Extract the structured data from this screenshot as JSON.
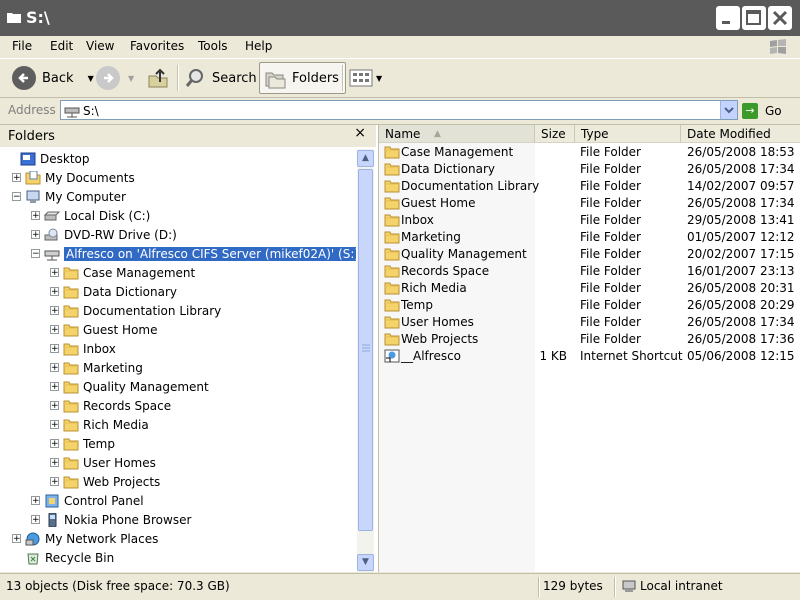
{
  "window": {
    "title": "S:\\"
  },
  "menu": [
    "File",
    "Edit",
    "View",
    "Favorites",
    "Tools",
    "Help"
  ],
  "toolbar": {
    "back": "Back",
    "search": "Search",
    "folders": "Folders"
  },
  "address": {
    "label": "Address",
    "value": "S:\\",
    "go": "Go"
  },
  "folders_pane": {
    "title": "Folders",
    "close": "×",
    "tree": [
      {
        "label": "Desktop",
        "icon": "desktop-icon",
        "level": 0,
        "expander": "none"
      },
      {
        "label": "My Documents",
        "icon": "my-documents-icon",
        "level": 1,
        "expander": "+"
      },
      {
        "label": "My Computer",
        "icon": "my-computer-icon",
        "level": 1,
        "expander": "-"
      },
      {
        "label": "Local Disk (C:)",
        "icon": "hard-disk-icon",
        "level": 2,
        "expander": "+"
      },
      {
        "label": "DVD-RW Drive (D:)",
        "icon": "dvd-drive-icon",
        "level": 2,
        "expander": "+"
      },
      {
        "label": "Alfresco on 'Alfresco CIFS Server (mikef02A)' (S:)",
        "icon": "network-drive-icon",
        "level": 2,
        "expander": "-",
        "selected": true
      },
      {
        "label": "Case Management",
        "icon": "folder-icon",
        "level": 3,
        "expander": "+"
      },
      {
        "label": "Data Dictionary",
        "icon": "folder-icon",
        "level": 3,
        "expander": "+"
      },
      {
        "label": "Documentation Library",
        "icon": "folder-icon",
        "level": 3,
        "expander": "+"
      },
      {
        "label": "Guest Home",
        "icon": "folder-icon",
        "level": 3,
        "expander": "+"
      },
      {
        "label": "Inbox",
        "icon": "folder-icon",
        "level": 3,
        "expander": "+"
      },
      {
        "label": "Marketing",
        "icon": "folder-icon",
        "level": 3,
        "expander": "+"
      },
      {
        "label": "Quality Management",
        "icon": "folder-icon",
        "level": 3,
        "expander": "+"
      },
      {
        "label": "Records Space",
        "icon": "folder-icon",
        "level": 3,
        "expander": "+"
      },
      {
        "label": "Rich Media",
        "icon": "folder-icon",
        "level": 3,
        "expander": "+"
      },
      {
        "label": "Temp",
        "icon": "folder-icon",
        "level": 3,
        "expander": "+"
      },
      {
        "label": "User Homes",
        "icon": "folder-icon",
        "level": 3,
        "expander": "+"
      },
      {
        "label": "Web Projects",
        "icon": "folder-icon",
        "level": 3,
        "expander": "+"
      },
      {
        "label": "Control Panel",
        "icon": "control-panel-icon",
        "level": 2,
        "expander": "+"
      },
      {
        "label": "Nokia Phone Browser",
        "icon": "phone-icon",
        "level": 2,
        "expander": "+"
      },
      {
        "label": "My Network Places",
        "icon": "network-places-icon",
        "level": 1,
        "expander": "+"
      },
      {
        "label": "Recycle Bin",
        "icon": "recycle-bin-icon",
        "level": 1,
        "expander": "none"
      }
    ]
  },
  "list": {
    "columns": [
      "Name",
      "Size",
      "Type",
      "Date Modified"
    ],
    "rows": [
      {
        "name": "Case Management",
        "size": "",
        "type": "File Folder",
        "date": "26/05/2008 18:53",
        "icon": "folder-icon"
      },
      {
        "name": "Data Dictionary",
        "size": "",
        "type": "File Folder",
        "date": "26/05/2008 17:34",
        "icon": "folder-icon"
      },
      {
        "name": "Documentation Library",
        "size": "",
        "type": "File Folder",
        "date": "14/02/2007 09:57",
        "icon": "folder-icon"
      },
      {
        "name": "Guest Home",
        "size": "",
        "type": "File Folder",
        "date": "26/05/2008 17:34",
        "icon": "folder-icon"
      },
      {
        "name": "Inbox",
        "size": "",
        "type": "File Folder",
        "date": "29/05/2008 13:41",
        "icon": "folder-icon"
      },
      {
        "name": "Marketing",
        "size": "",
        "type": "File Folder",
        "date": "01/05/2007 12:12",
        "icon": "folder-icon"
      },
      {
        "name": "Quality Management",
        "size": "",
        "type": "File Folder",
        "date": "20/02/2007 17:15",
        "icon": "folder-icon"
      },
      {
        "name": "Records Space",
        "size": "",
        "type": "File Folder",
        "date": "16/01/2007 23:13",
        "icon": "folder-icon"
      },
      {
        "name": "Rich Media",
        "size": "",
        "type": "File Folder",
        "date": "26/05/2008 20:31",
        "icon": "folder-icon"
      },
      {
        "name": "Temp",
        "size": "",
        "type": "File Folder",
        "date": "26/05/2008 20:29",
        "icon": "folder-icon"
      },
      {
        "name": "User Homes",
        "size": "",
        "type": "File Folder",
        "date": "26/05/2008 17:34",
        "icon": "folder-icon"
      },
      {
        "name": "Web Projects",
        "size": "",
        "type": "File Folder",
        "date": "26/05/2008 17:36",
        "icon": "folder-icon"
      },
      {
        "name": "__Alfresco",
        "size": "1 KB",
        "type": "Internet Shortcut",
        "date": "05/06/2008 12:15",
        "icon": "internet-shortcut-icon"
      }
    ]
  },
  "status": {
    "objects": "13 objects (Disk free space: 70.3 GB)",
    "size": "129 bytes",
    "zone": "Local intranet"
  },
  "colors": {
    "selection": "#316ac5",
    "folder_yellow": "#f5d36b",
    "chrome": "#ece9d8"
  }
}
